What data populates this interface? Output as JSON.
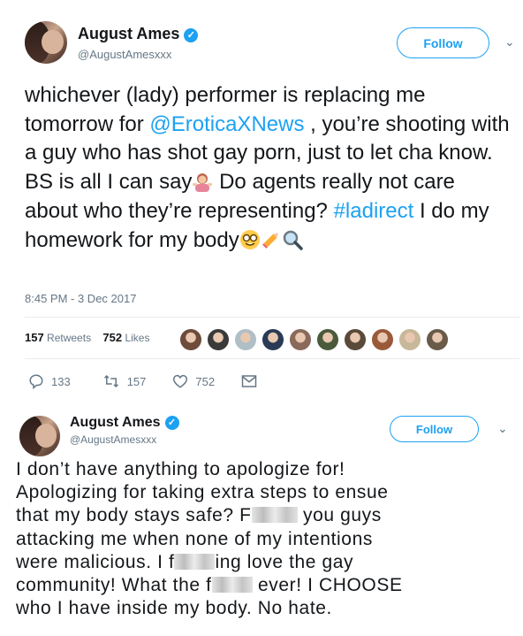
{
  "tweet1": {
    "name": "August Ames",
    "handle": "@AugustAmesxxx",
    "follow_label": "Follow",
    "text_1": "whichever (lady) performer is replacing me tomorrow for ",
    "mention": "@EroticaXNews",
    "text_2": " , you’re shooting with a guy who has shot gay porn, just to let cha know.  BS is all I can say",
    "text_3": " Do agents really not care about who they’re representing? ",
    "hashtag": "#ladirect",
    "text_4": " I do my homework for my body",
    "timestamp": "8:45 PM - 3 Dec 2017",
    "retweets_count": "157",
    "retweets_label": "Retweets",
    "likes_count": "752",
    "likes_label": "Likes",
    "reply_count": "133",
    "retweet_count": "157",
    "like_count": "752",
    "likers": [
      "#6e4b3a",
      "#3a3a3a",
      "#b0bec5",
      "#2b3a55",
      "#8a6a5a",
      "#4a5a3a",
      "#5a4a3a",
      "#9a5a3a",
      "#c8b89a",
      "#6a5a4a"
    ]
  },
  "tweet2": {
    "name": "August Ames",
    "handle": "@AugustAmesxxx",
    "follow_label": "Follow",
    "line_1": "I don’t have anything to apologize for!",
    "line_2": "Apologizing for taking extra steps to ensue",
    "line_3": "that my body stays safe? F",
    "line_3b": " you guys",
    "line_4": "attacking me when none of my intentions",
    "line_5": "were malicious. I f",
    "line_5b": "ing love the gay",
    "line_6": "community! What the f",
    "line_6b": " ever! I CHOOSE",
    "line_7": "who I have inside my body. No hate."
  },
  "colors": {
    "accent": "#1da1f2",
    "text": "#14171a",
    "muted": "#657786",
    "divider": "#e6ecf0"
  }
}
